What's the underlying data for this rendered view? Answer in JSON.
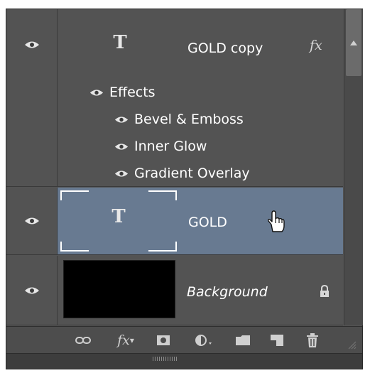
{
  "layers": [
    {
      "name": "GOLD copy",
      "type": "text",
      "has_fx": true,
      "fx_label": "fx",
      "effects_label": "Effects",
      "effects": [
        "Bevel & Emboss",
        "Inner Glow",
        "Gradient Overlay"
      ]
    },
    {
      "name": "GOLD",
      "type": "text",
      "selected": true
    },
    {
      "name": "Background",
      "type": "image",
      "locked": true
    }
  ],
  "type_glyph": "T",
  "toolbar": {
    "items": [
      "link-layers",
      "add-layer-style",
      "add-mask",
      "new-adjustment-layer",
      "new-group",
      "new-layer",
      "delete-layer"
    ],
    "fx_label": "fx"
  },
  "colors": {
    "panel_bg": "#535353",
    "selected_row": "#687a91",
    "text": "#ffffff"
  }
}
